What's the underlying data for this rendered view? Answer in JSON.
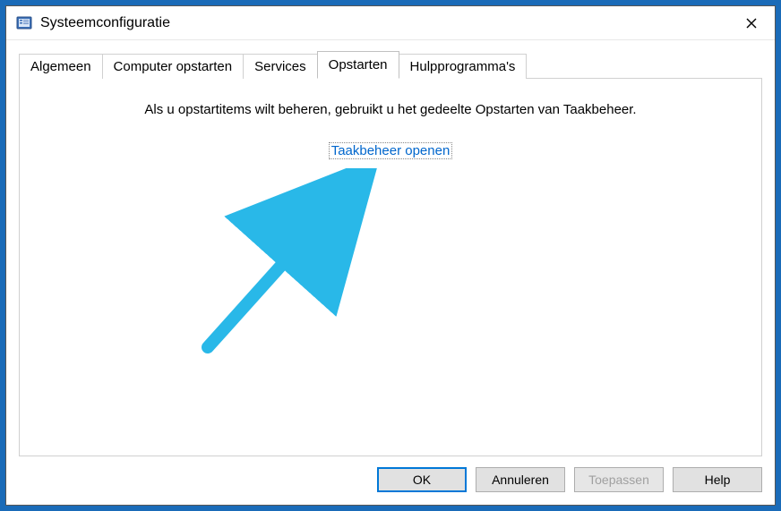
{
  "window": {
    "title": "Systeemconfiguratie"
  },
  "tabs": [
    {
      "label": "Algemeen",
      "active": false
    },
    {
      "label": "Computer opstarten",
      "active": false
    },
    {
      "label": "Services",
      "active": false
    },
    {
      "label": "Opstarten",
      "active": true
    },
    {
      "label": "Hulpprogramma's",
      "active": false
    }
  ],
  "content": {
    "info_text": "Als u opstartitems wilt beheren, gebruikt u het gedeelte Opstarten van Taakbeheer.",
    "link_text": "Taakbeheer openen"
  },
  "buttons": {
    "ok": "OK",
    "cancel": "Annuleren",
    "apply": "Toepassen",
    "help": "Help"
  },
  "annotation": {
    "arrow_color": "#29b8e8"
  }
}
